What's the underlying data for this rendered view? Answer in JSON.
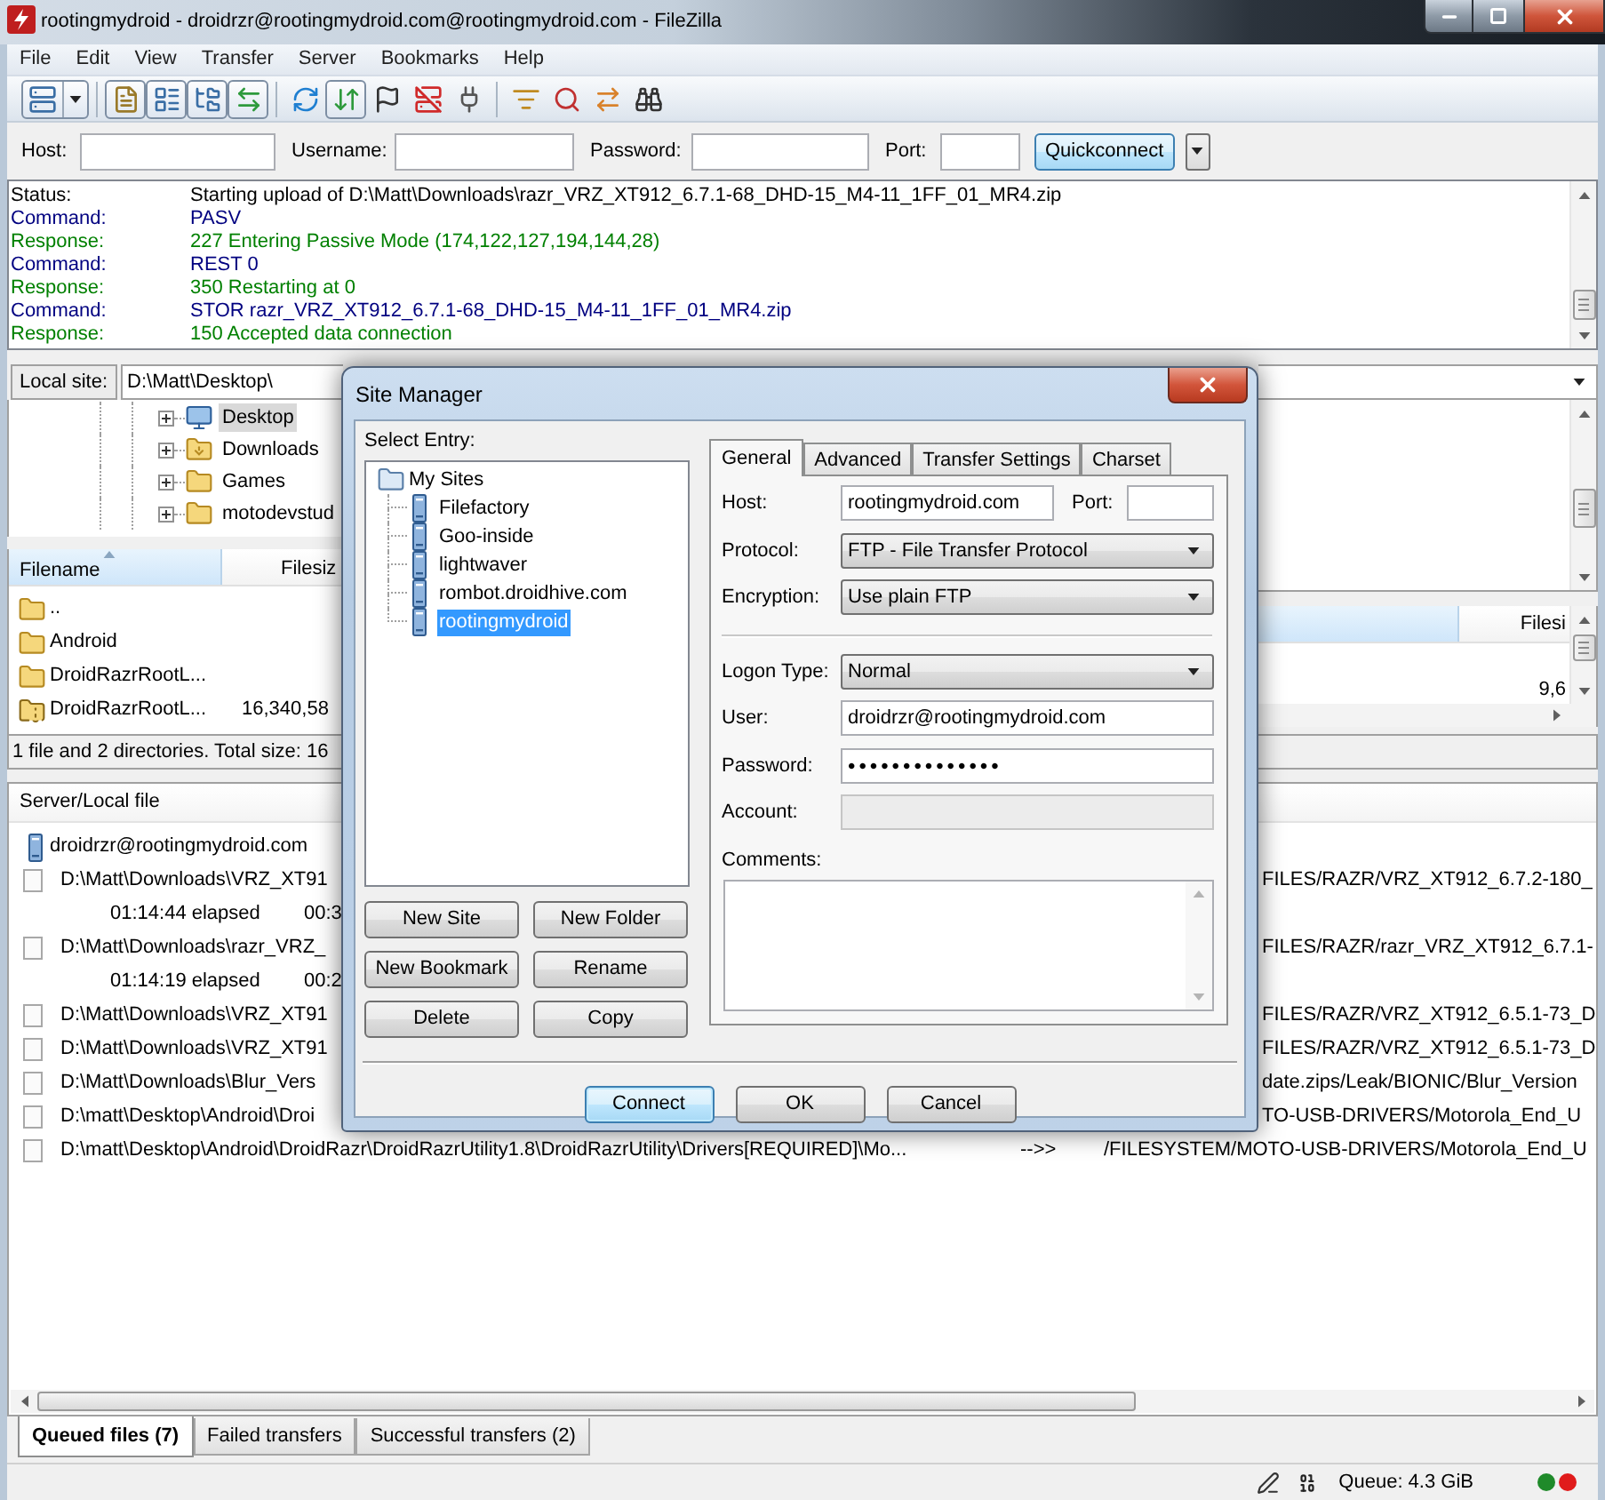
{
  "window": {
    "title": "rootingmydroid - droidrzr@rootingmydroid.com@rootingmydroid.com - FileZilla"
  },
  "menu": [
    "File",
    "Edit",
    "View",
    "Transfer",
    "Server",
    "Bookmarks",
    "Help"
  ],
  "toolbar": [
    {
      "pressed": false
    },
    {
      "pressed": true
    },
    {
      "pressed": true
    },
    {
      "pressed": true
    },
    {
      "pressed": true
    },
    {
      "pressed": false
    },
    {
      "pressed": true
    },
    {
      "pressed": false
    },
    {
      "pressed": false
    },
    {
      "pressed": false
    },
    {
      "pressed": false
    },
    {
      "pressed": false
    },
    {
      "pressed": false
    },
    {
      "pressed": false
    }
  ],
  "quickconnect": {
    "fields": [
      {
        "label": "Host:"
      },
      {
        "label": "Username:"
      },
      {
        "label": "Password:"
      },
      {
        "label": "Port:"
      }
    ],
    "button": "Quickconnect"
  },
  "log": [
    {
      "kind": "status",
      "label": "Status:",
      "text": "Starting upload of D:\\Matt\\Downloads\\razr_VRZ_XT912_6.7.1-68_DHD-15_M4-11_1FF_01_MR4.zip"
    },
    {
      "kind": "command",
      "label": "Command:",
      "text": "PASV"
    },
    {
      "kind": "response",
      "label": "Response:",
      "text": "227 Entering Passive Mode (174,122,127,194,144,28)"
    },
    {
      "kind": "command",
      "label": "Command:",
      "text": "REST 0"
    },
    {
      "kind": "response",
      "label": "Response:",
      "text": "350 Restarting at 0"
    },
    {
      "kind": "command",
      "label": "Command:",
      "text": "STOR razr_VRZ_XT912_6.7.1-68_DHD-15_M4-11_1FF_01_MR4.zip"
    },
    {
      "kind": "response",
      "label": "Response:",
      "text": "150 Accepted data connection"
    }
  ],
  "local": {
    "label": "Local site:",
    "path": "D:\\Matt\\Desktop\\",
    "tree": [
      {
        "kind": "desktop",
        "name": "Desktop",
        "selected": true,
        "expanded": false
      },
      {
        "kind": "downloads",
        "name": "Downloads",
        "selected": false,
        "expanded": false
      },
      {
        "kind": "folder",
        "name": "Games",
        "selected": false,
        "expanded": false
      },
      {
        "kind": "folder",
        "name": "motodevstud",
        "selected": false,
        "expanded": false
      }
    ],
    "columns": [
      "Filename",
      "Filesiz"
    ],
    "files": [
      {
        "kind": "folder",
        "name": ".."
      },
      {
        "kind": "folder",
        "name": "Android"
      },
      {
        "kind": "folder",
        "name": "DroidRazrRootL..."
      },
      {
        "kind": "archive",
        "name": "DroidRazrRootL...",
        "size": "16,340,58"
      }
    ],
    "status": "1 file and 2 directories. Total size: 16"
  },
  "remote": {
    "columns": [
      "Filesi"
    ],
    "files": [
      {
        "size": "9,6"
      }
    ]
  },
  "queue": {
    "columns": [
      "Server/Local file"
    ],
    "rows": [
      {
        "kind": "server",
        "local": "droidrzr@rootingmydroid.com"
      },
      {
        "kind": "file",
        "local": "D:\\Matt\\Downloads\\VRZ_XT91",
        "remote": "FILES/RAZR/VRZ_XT912_6.7.2-180_"
      },
      {
        "kind": "progress",
        "elapsed": "01:14:44 elapsed",
        "remaining": "00:3"
      },
      {
        "kind": "file",
        "local": "D:\\Matt\\Downloads\\razr_VRZ_",
        "remote": "FILES/RAZR/razr_VRZ_XT912_6.7.1-"
      },
      {
        "kind": "progress",
        "elapsed": "01:14:19 elapsed",
        "remaining": "00:2"
      },
      {
        "kind": "file",
        "local": "D:\\Matt\\Downloads\\VRZ_XT91",
        "remote": "FILES/RAZR/VRZ_XT912_6.5.1-73_D"
      },
      {
        "kind": "file",
        "local": "D:\\Matt\\Downloads\\VRZ_XT91",
        "remote": "FILES/RAZR/VRZ_XT912_6.5.1-73_D"
      },
      {
        "kind": "file",
        "local": "D:\\Matt\\Downloads\\Blur_Vers",
        "remote": "date.zips/Leak/BIONIC/Blur_Version"
      },
      {
        "kind": "file",
        "local": "D:\\matt\\Desktop\\Android\\Droi",
        "remote": "TO-USB-DRIVERS/Motorola_End_U"
      },
      {
        "kind": "file",
        "local": "D:\\matt\\Desktop\\Android\\DroidRazr\\DroidRazrUtility1.8\\DroidRazrUtility\\Drivers[REQUIRED]\\Mo...",
        "direction": "-->>",
        "remote": "/FILESYSTEM/MOTO-USB-DRIVERS/Motorola_End_U"
      }
    ]
  },
  "queue_tabs": [
    {
      "label": "Queued files (7)",
      "selected": true
    },
    {
      "label": "Failed transfers",
      "selected": false
    },
    {
      "label": "Successful transfers (2)",
      "selected": false
    }
  ],
  "status_bar": {
    "queue": "Queue: 4.3 GiB"
  },
  "site_manager": {
    "title": "Site Manager",
    "select_label": "Select Entry:",
    "tree": {
      "name": "My Sites",
      "children": [
        {
          "name": "Filefactory",
          "selected": false
        },
        {
          "name": "Goo-inside",
          "selected": false
        },
        {
          "name": "lightwaver",
          "selected": false
        },
        {
          "name": "rombot.droidhive.com",
          "selected": false
        },
        {
          "name": "rootingmydroid",
          "selected": true
        }
      ]
    },
    "entry_buttons": [
      "New Site",
      "New Folder",
      "New Bookmark",
      "Rename",
      "Delete",
      "Copy"
    ],
    "tabs": [
      {
        "label": "General",
        "selected": true
      },
      {
        "label": "Advanced",
        "selected": false
      },
      {
        "label": "Transfer Settings",
        "selected": false
      },
      {
        "label": "Charset",
        "selected": false
      }
    ],
    "general": {
      "host": {
        "label": "Host:",
        "value": "rootingmydroid.com"
      },
      "port": {
        "label": "Port:"
      },
      "protocol": {
        "label": "Protocol:",
        "value": "FTP - File Transfer Protocol"
      },
      "encryption": {
        "label": "Encryption:",
        "value": "Use plain FTP"
      },
      "logon_type": {
        "label": "Logon Type:",
        "value": "Normal"
      },
      "user": {
        "label": "User:",
        "value": "droidrzr@rootingmydroid.com"
      },
      "password": {
        "label": "Password:",
        "value": "••••••••••••••"
      },
      "account": {
        "label": "Account:",
        "disabled": true
      },
      "comments": {
        "label": "Comments:"
      }
    },
    "buttons": [
      {
        "label": "Connect",
        "default": true
      },
      {
        "label": "OK",
        "default": false
      },
      {
        "label": "Cancel",
        "default": false
      }
    ]
  }
}
